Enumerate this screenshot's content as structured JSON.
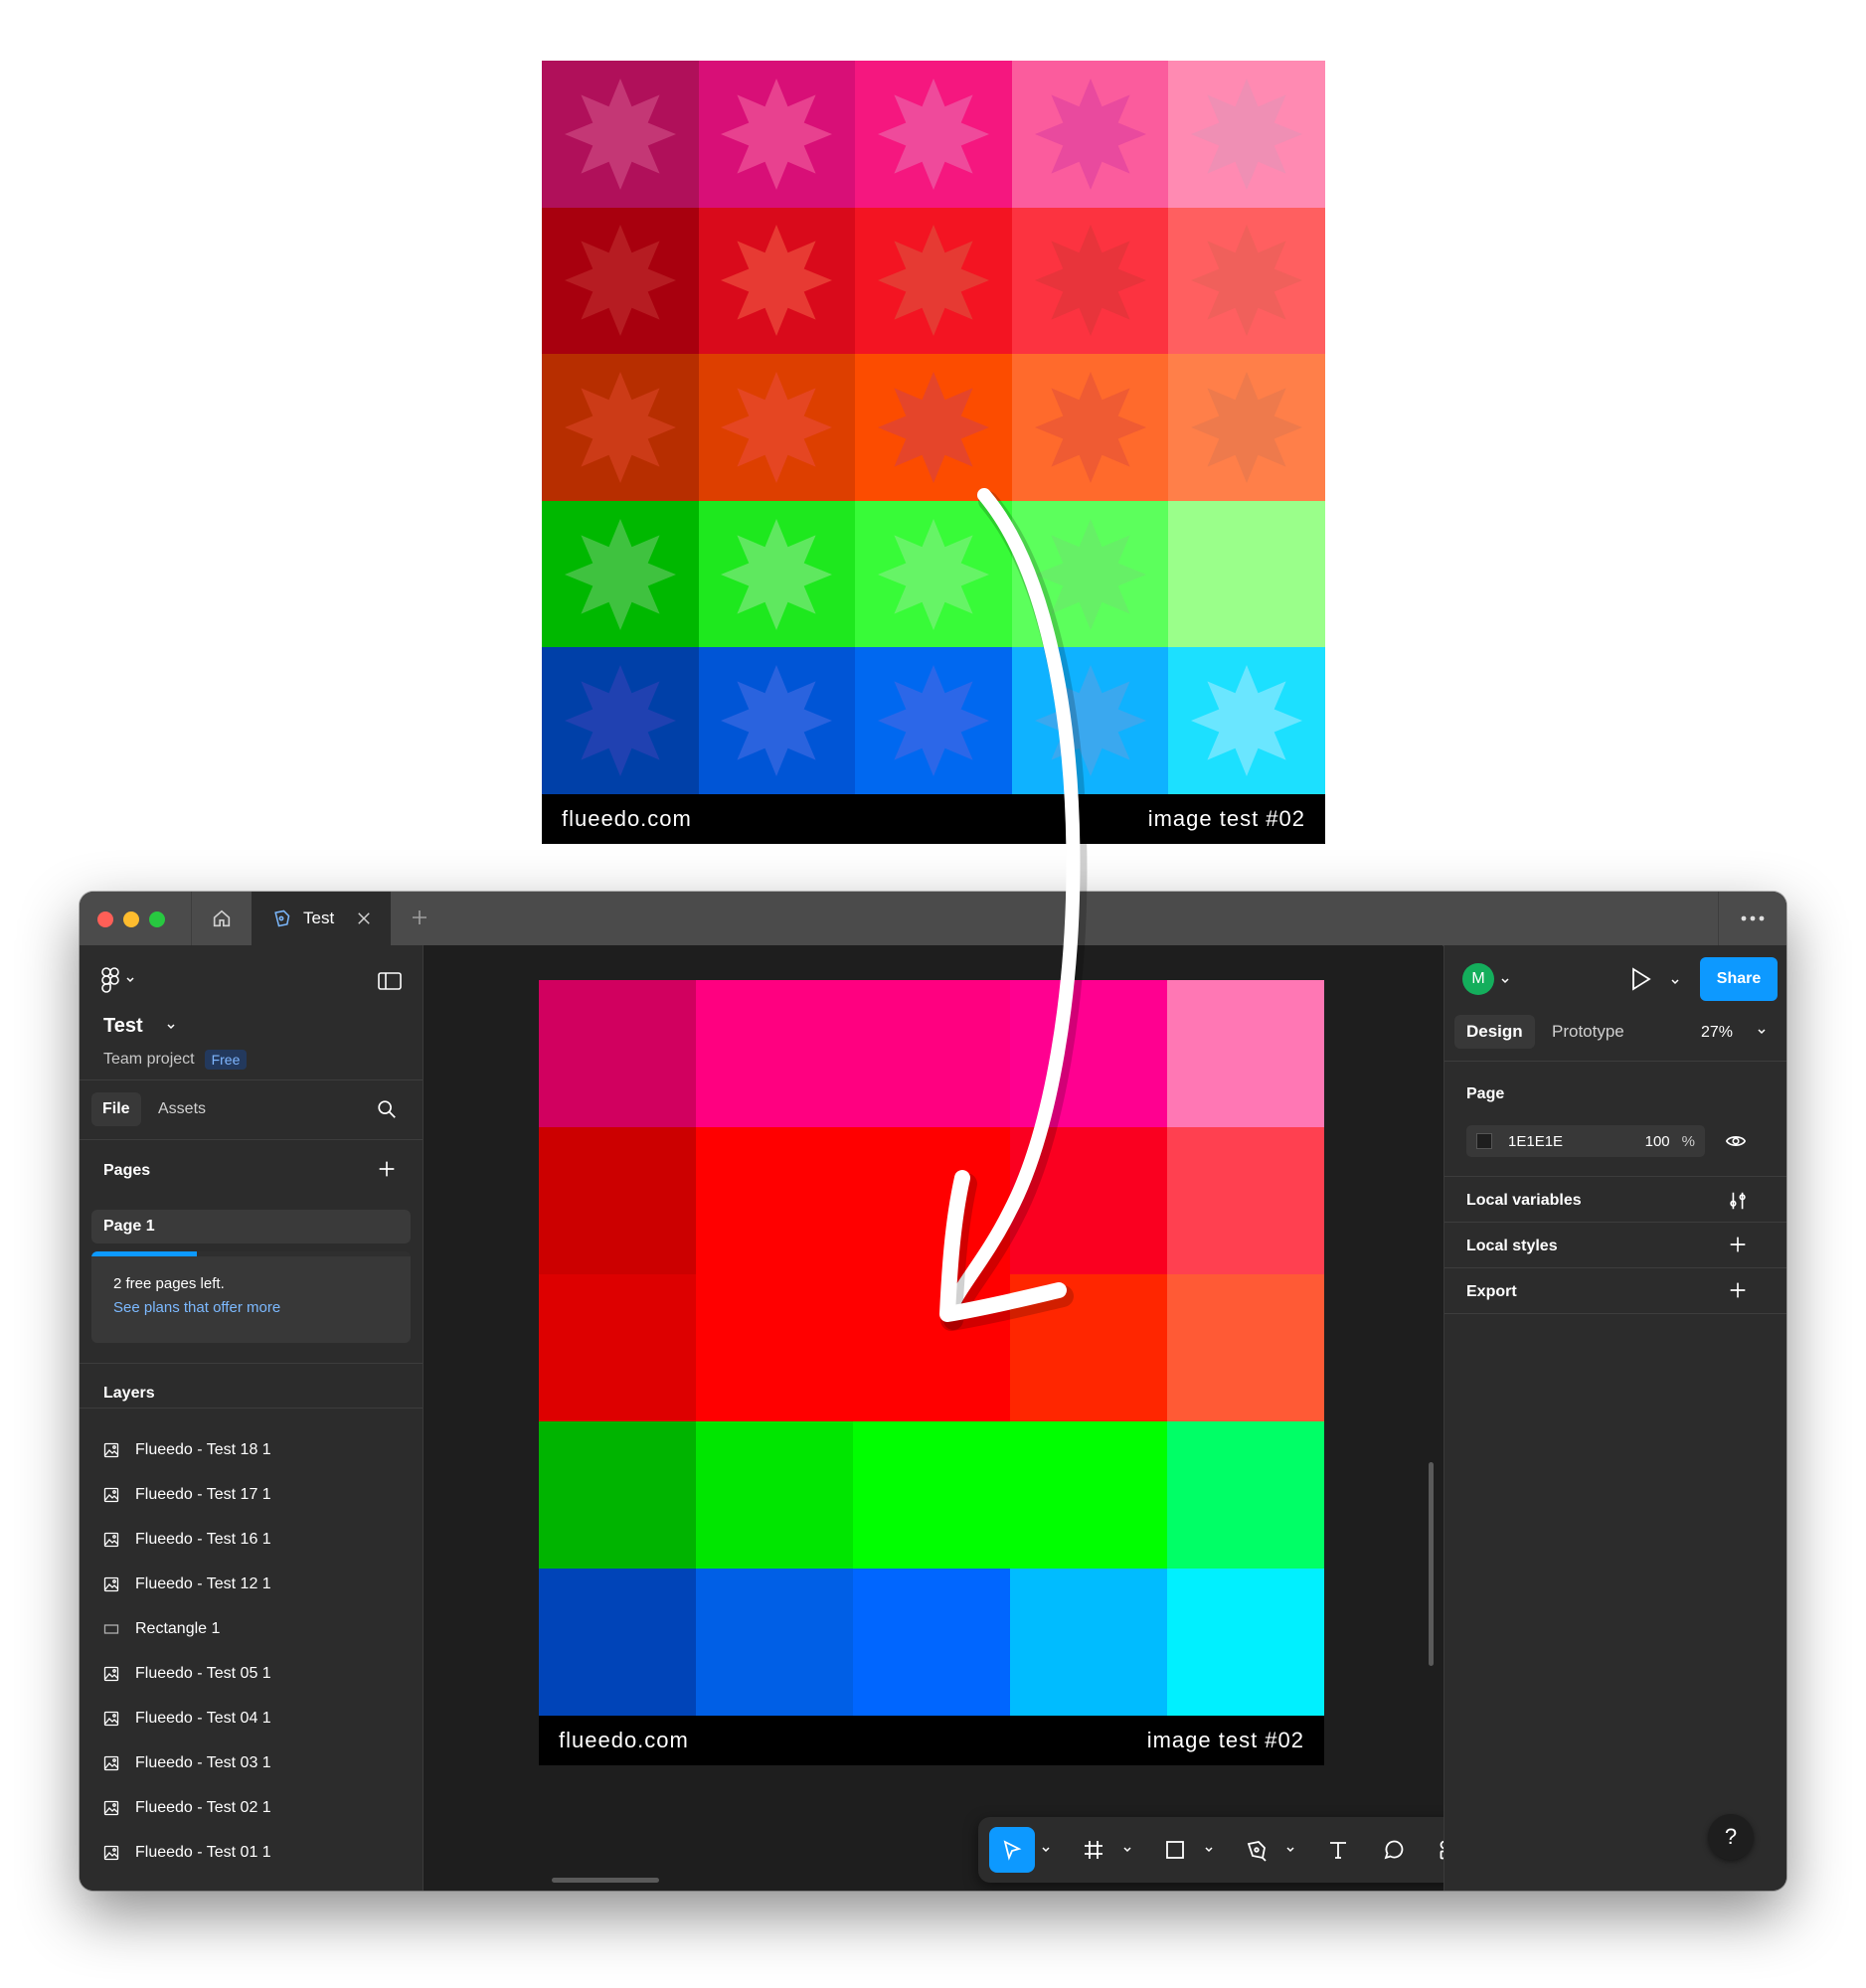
{
  "reference_image": {
    "footer_left": "flueedo.com",
    "footer_right": "image test #02",
    "rows": [
      [
        "#b0105a",
        "#d80f77",
        "#f5177f",
        "#fb5c9d",
        "#ff8ab2"
      ],
      [
        "#a8000e",
        "#d90a1b",
        "#f31422",
        "#fc3340",
        "#ff5f60"
      ],
      [
        "#b72e00",
        "#dd3f00",
        "#fc4c00",
        "#ff6a2c",
        "#ff7f49"
      ],
      [
        "#00b800",
        "#1ee81e",
        "#38fb38",
        "#5cff5c",
        "#9aff8a"
      ],
      [
        "#0040a8",
        "#0055d6",
        "#0068f0",
        "#0fb2ff",
        "#1ce0ff"
      ]
    ],
    "star_colors": [
      [
        "#c43775",
        "#e8418f",
        "#ef4a9b",
        "#e94a9e",
        "#ef8fb4"
      ],
      [
        "#b61c22",
        "#e73a33",
        "#e63a33",
        "#e8343b",
        "#f0605b"
      ],
      [
        "#cc3b17",
        "#e54622",
        "#e5452a",
        "#ef5b33",
        "#ee7a4c"
      ],
      [
        "#3fc23f",
        "#5fe85f",
        "#66f466",
        "#66f066",
        "#9aff8a"
      ],
      [
        "#2041b1",
        "#2a63de",
        "#2c67e8",
        "#3aa8ef",
        "#6ae6ff"
      ]
    ]
  },
  "window": {
    "tab_title": "Test",
    "more_icon": "ellipsis-icon"
  },
  "left_panel": {
    "project_name": "Test",
    "project_subtitle": "Team project",
    "plan_badge": "Free",
    "tabs": [
      "File",
      "Assets"
    ],
    "pages_title": "Pages",
    "current_page": "Page 1",
    "promo_line1": "2 free pages left.",
    "promo_link": "See plans that offer more",
    "promo_progress": 0.33,
    "layers_title": "Layers",
    "layers": [
      {
        "name": "Flueedo - Test 18 1",
        "icon": "image-icon"
      },
      {
        "name": "Flueedo - Test 17 1",
        "icon": "image-icon"
      },
      {
        "name": "Flueedo - Test 16 1",
        "icon": "image-icon"
      },
      {
        "name": "Flueedo - Test 12 1",
        "icon": "image-icon"
      },
      {
        "name": "Rectangle 1",
        "icon": "rectangle-icon"
      },
      {
        "name": "Flueedo - Test 05 1",
        "icon": "image-icon"
      },
      {
        "name": "Flueedo - Test 04 1",
        "icon": "image-icon"
      },
      {
        "name": "Flueedo - Test 03 1",
        "icon": "image-icon"
      },
      {
        "name": "Flueedo - Test 02 1",
        "icon": "image-icon"
      },
      {
        "name": "Flueedo - Test 01 1",
        "icon": "image-icon"
      }
    ]
  },
  "canvas_image": {
    "footer_left": "flueedo.com",
    "footer_right": "image test #02",
    "rows": [
      [
        "#d1005f",
        "#ff0080",
        "#ff0080",
        "#ff0090",
        "#ff77b4"
      ],
      [
        "#cc0000",
        "#ff0000",
        "#ff0000",
        "#fa0020",
        "#ff4050"
      ],
      [
        "#dd0000",
        "#ff0000",
        "#ff0000",
        "#ff2600",
        "#ff5a35"
      ],
      [
        "#00b400",
        "#00e600",
        "#00ff00",
        "#00ff00",
        "#00ff66"
      ],
      [
        "#0044b8",
        "#005fe6",
        "#0066ff",
        "#00bcff",
        "#00f0ff"
      ]
    ]
  },
  "right_panel": {
    "avatar_initial": "M",
    "share_label": "Share",
    "tabs": [
      "Design",
      "Prototype"
    ],
    "zoom": "27%",
    "page_title": "Page",
    "page_color_hex": "1E1E1E",
    "page_color": "#1e1e1e",
    "page_opacity": "100",
    "page_opacity_unit": "%",
    "local_variables": "Local variables",
    "local_styles": "Local styles",
    "export": "Export",
    "help_label": "?"
  },
  "colors": {
    "accent": "#0d99ff",
    "panel": "#2c2c2c",
    "canvas": "#1e1e1e",
    "titlebar": "#4b4b4b",
    "traffic_red": "#ff5f57",
    "traffic_yellow": "#febc2e",
    "traffic_green": "#28c840"
  }
}
